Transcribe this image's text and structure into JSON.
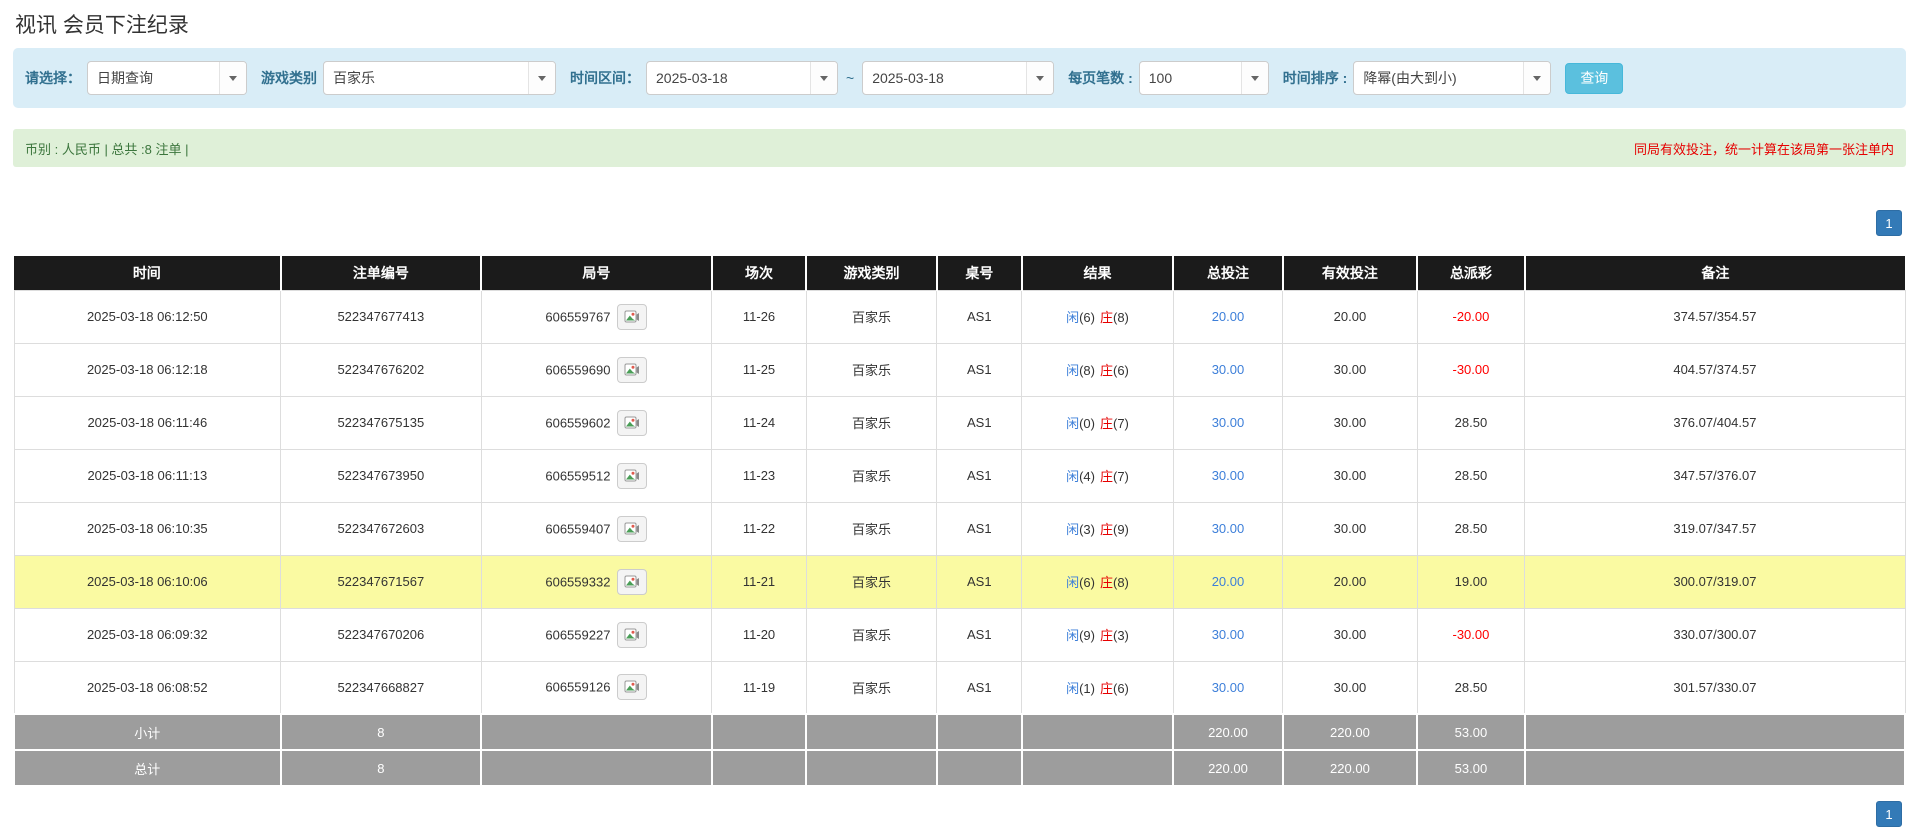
{
  "page": {
    "title": "视讯 会员下注纪录"
  },
  "filters": {
    "select_label": "请选择：",
    "select_value": "日期查询",
    "game_label": "游戏类别",
    "game_value": "百家乐",
    "range_label": "时间区间：",
    "date_from": "2025-03-18",
    "range_sep": "~",
    "date_to": "2025-03-18",
    "per_page_label": "每页笔数 :",
    "per_page_value": "100",
    "sort_label": "时间排序 :",
    "sort_value": "降幂(由大到小)",
    "search_label": "查询"
  },
  "summary": {
    "left": "币别 : 人民币 | 总共 :8 注单 |",
    "right_note": "同局有效投注，统一计算在该局第一张注单内"
  },
  "pagination": {
    "page": "1"
  },
  "colors": {
    "accent_blue": "#5bc0de",
    "link_blue": "#3d7fd9",
    "negative_red": "#ff0000",
    "panel_blue": "#d9edf7",
    "summary_green": "#dff0d8",
    "header_black": "#1b1b1b",
    "highlight_yellow": "#fafaa2",
    "footer_grey": "#9d9d9d"
  },
  "icons": {
    "dropdown_caret": "chevron-down",
    "round_media": "video-replay"
  },
  "table": {
    "headers": [
      "时间",
      "注单编号",
      "局号",
      "场次",
      "游戏类别",
      "桌号",
      "结果",
      "总投注",
      "有效投注",
      "总派彩",
      "备注"
    ],
    "col_widths": [
      "14.1%",
      "10.6%",
      "12.2%",
      "5.0%",
      "6.9%",
      "4.5%",
      "8.0%",
      "5.8%",
      "7.1%",
      "5.7%",
      "20.1%"
    ],
    "rows": [
      {
        "time": "2025-03-18 06:12:50",
        "bet_id": "522347677413",
        "round": "606559767",
        "session": "11-26",
        "game": "百家乐",
        "table_no": "AS1",
        "player": "闲",
        "player_n": "(6)",
        "banker": "庄",
        "banker_n": "(8)",
        "total_bet": "20.00",
        "valid_bet": "20.00",
        "payout": "-20.00",
        "note": "374.57/354.57",
        "highlight": false
      },
      {
        "time": "2025-03-18 06:12:18",
        "bet_id": "522347676202",
        "round": "606559690",
        "session": "11-25",
        "game": "百家乐",
        "table_no": "AS1",
        "player": "闲",
        "player_n": "(8)",
        "banker": "庄",
        "banker_n": "(6)",
        "total_bet": "30.00",
        "valid_bet": "30.00",
        "payout": "-30.00",
        "note": "404.57/374.57",
        "highlight": false
      },
      {
        "time": "2025-03-18 06:11:46",
        "bet_id": "522347675135",
        "round": "606559602",
        "session": "11-24",
        "game": "百家乐",
        "table_no": "AS1",
        "player": "闲",
        "player_n": "(0)",
        "banker": "庄",
        "banker_n": "(7)",
        "total_bet": "30.00",
        "valid_bet": "30.00",
        "payout": "28.50",
        "note": "376.07/404.57",
        "highlight": false
      },
      {
        "time": "2025-03-18 06:11:13",
        "bet_id": "522347673950",
        "round": "606559512",
        "session": "11-23",
        "game": "百家乐",
        "table_no": "AS1",
        "player": "闲",
        "player_n": "(4)",
        "banker": "庄",
        "banker_n": "(7)",
        "total_bet": "30.00",
        "valid_bet": "30.00",
        "payout": "28.50",
        "note": "347.57/376.07",
        "highlight": false
      },
      {
        "time": "2025-03-18 06:10:35",
        "bet_id": "522347672603",
        "round": "606559407",
        "session": "11-22",
        "game": "百家乐",
        "table_no": "AS1",
        "player": "闲",
        "player_n": "(3)",
        "banker": "庄",
        "banker_n": "(9)",
        "total_bet": "30.00",
        "valid_bet": "30.00",
        "payout": "28.50",
        "note": "319.07/347.57",
        "highlight": false
      },
      {
        "time": "2025-03-18 06:10:06",
        "bet_id": "522347671567",
        "round": "606559332",
        "session": "11-21",
        "game": "百家乐",
        "table_no": "AS1",
        "player": "闲",
        "player_n": "(6)",
        "banker": "庄",
        "banker_n": "(8)",
        "total_bet": "20.00",
        "valid_bet": "20.00",
        "payout": "19.00",
        "note": "300.07/319.07",
        "highlight": true
      },
      {
        "time": "2025-03-18 06:09:32",
        "bet_id": "522347670206",
        "round": "606559227",
        "session": "11-20",
        "game": "百家乐",
        "table_no": "AS1",
        "player": "闲",
        "player_n": "(9)",
        "banker": "庄",
        "banker_n": "(3)",
        "total_bet": "30.00",
        "valid_bet": "30.00",
        "payout": "-30.00",
        "note": "330.07/300.07",
        "highlight": false
      },
      {
        "time": "2025-03-18 06:08:52",
        "bet_id": "522347668827",
        "round": "606559126",
        "session": "11-19",
        "game": "百家乐",
        "table_no": "AS1",
        "player": "闲",
        "player_n": "(1)",
        "banker": "庄",
        "banker_n": "(6)",
        "total_bet": "30.00",
        "valid_bet": "30.00",
        "payout": "28.50",
        "note": "301.57/330.07",
        "highlight": false
      }
    ],
    "footer": [
      {
        "label": "小计",
        "count": "8",
        "total_bet": "220.00",
        "valid_bet": "220.00",
        "payout": "53.00"
      },
      {
        "label": "总计",
        "count": "8",
        "total_bet": "220.00",
        "valid_bet": "220.00",
        "payout": "53.00"
      }
    ]
  }
}
